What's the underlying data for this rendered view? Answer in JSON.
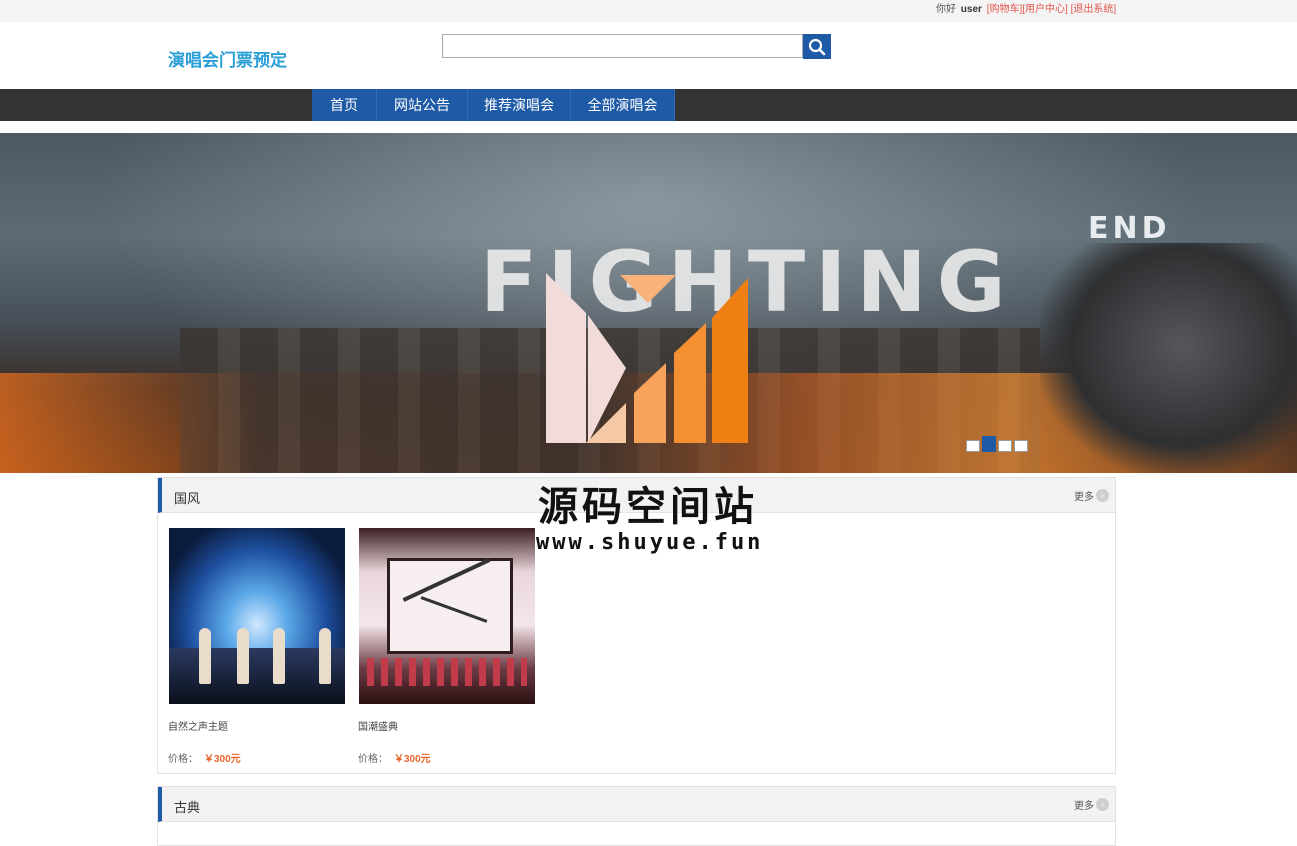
{
  "topbar": {
    "greeting": "你好",
    "username": "user",
    "cart_link": "[购物车]",
    "user_center_link": "[用户中心]",
    "logout_link": "[退出系统]"
  },
  "header": {
    "logo": "演唱会门票预定",
    "search": {
      "value": "",
      "placeholder": ""
    }
  },
  "nav": {
    "items": [
      "首页",
      "网站公告",
      "推荐演唱会",
      "全部演唱会"
    ]
  },
  "banner": {
    "title_small": "END",
    "title_main": "FIGHTING",
    "slide_count": 4,
    "active_slide": 2
  },
  "watermark": {
    "title": "源码空间站",
    "url": "www.shuyue.fun"
  },
  "sections": [
    {
      "title": "国风",
      "more": "更多",
      "items": [
        {
          "name": "自然之声主题",
          "price_label": "价格：",
          "price": "￥300元"
        },
        {
          "name": "国潮盛典",
          "price_label": "价格：",
          "price": "￥300元"
        }
      ]
    },
    {
      "title": "古典",
      "more": "更多",
      "items": []
    }
  ],
  "colors": {
    "brand_blue": "#1f5aa6",
    "nav_bg": "#333333",
    "logo_blue": "#2a9fd6",
    "price_orange": "#e8652c",
    "link_red": "#e2574c"
  }
}
